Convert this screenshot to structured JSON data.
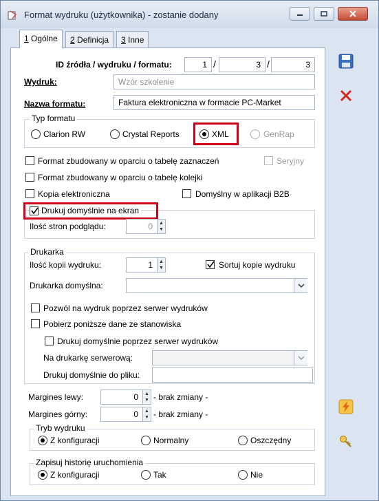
{
  "window": {
    "title": "Format wydruku (użytkownika) - zostanie dodany"
  },
  "tabs": [
    {
      "key": "1",
      "label": " Ogólne"
    },
    {
      "key": "2",
      "label": " Definicja"
    },
    {
      "key": "3",
      "label": " Inne"
    }
  ],
  "id": {
    "label": "ID źródła / wydruku / formatu:",
    "source": "1",
    "print": "3",
    "format": "3"
  },
  "wydruk": {
    "label": "Wydruk:",
    "value": "Wzór szkolenie"
  },
  "nazwa": {
    "label": "Nazwa formatu:",
    "value": "Faktura elektroniczna w formacie PC-Market"
  },
  "typ": {
    "legend": "Typ formatu",
    "options": [
      "Clarion RW",
      "Crystal Reports",
      "XML",
      "GenRap"
    ],
    "selected": "XML"
  },
  "checks": {
    "zaznaczen": "Format zbudowany w oparciu o tabelę zaznaczeń",
    "seryjny": "Seryjny",
    "kolejki": "Format zbudowany w oparciu o tabelę kolejki",
    "kopia": "Kopia elektroniczna",
    "b2b": "Domyślny w aplikacji B2B",
    "ekran": "Drukuj domyślnie na ekran"
  },
  "podglad": {
    "label": "Ilość stron podglądu:",
    "value": "0"
  },
  "drukarka": {
    "legend": "Drukarka",
    "kopie_label": "Ilość kopii wydruku:",
    "kopie_value": "1",
    "sortuj": "Sortuj kopie wydruku",
    "domyslna_label": "Drukarka domyślna:",
    "domyslna_value": "",
    "serwer": "Pozwól na wydruk poprzez serwer wydruków",
    "pobierz": "Pobierz poniższe dane ze stanowiska",
    "drukuj_serwer": "Drukuj domyślnie poprzez serwer wydruków",
    "na_drukarke_label": "Na drukarkę serwerową:",
    "na_drukarke_value": "",
    "do_pliku_label": "Drukuj domyślnie do pliku:",
    "do_pliku_value": ""
  },
  "margins": {
    "lewy_label": "Margines lewy:",
    "lewy_value": "0",
    "gorny_label": "Margines górny:",
    "gorny_value": "0",
    "suffix": "- brak zmiany -"
  },
  "tryb": {
    "legend": "Tryb wydruku",
    "options": [
      "Z konfiguracji",
      "Normalny",
      "Oszczędny"
    ],
    "selected": "Z konfiguracji"
  },
  "historia": {
    "legend": "Zapisuj historię uruchomienia",
    "options": [
      "Z konfiguracji",
      "Tak",
      "Nie"
    ],
    "selected": "Z konfiguracji"
  },
  "icons": {
    "save": "save-icon",
    "cancel": "cancel-icon",
    "lightning": "lightning-icon",
    "key": "key-icon"
  },
  "colors": {
    "highlight_box": "#d0021b",
    "accent": "#2a5aa8"
  }
}
